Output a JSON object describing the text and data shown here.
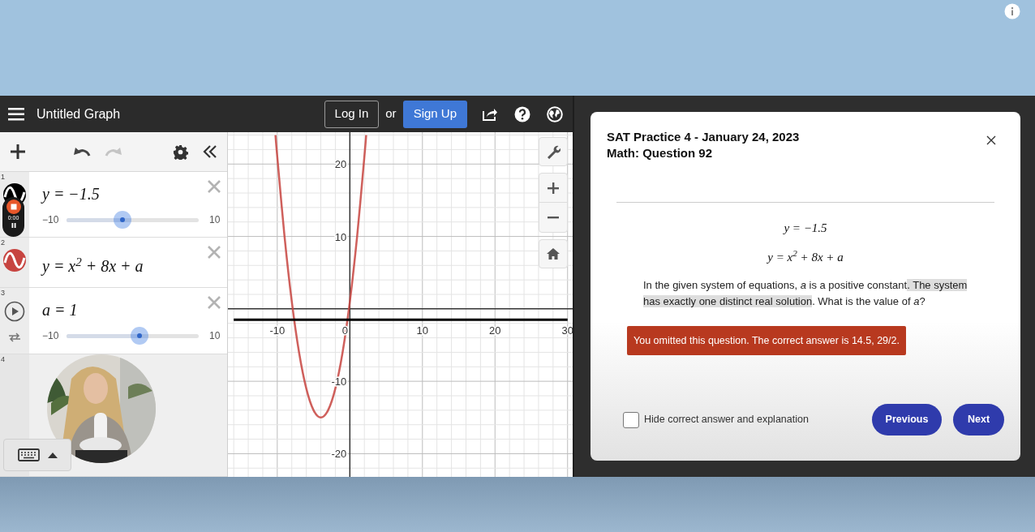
{
  "desmos": {
    "title": "Untitled Graph",
    "login": "Log In",
    "or": "or",
    "signup": "Sign Up",
    "expressions": [
      {
        "kind": "graph",
        "number": "1",
        "color": "#000000",
        "expression": "y = −1.5",
        "slider": {
          "min": "−10",
          "max": "10",
          "level": 0.425
        }
      },
      {
        "kind": "graph",
        "number": "2",
        "color": "#c74440",
        "expression": "y = x$^{2}$ + 8x + a"
      },
      {
        "kind": "variable",
        "number": "3",
        "expression": "a = 1",
        "slider": {
          "min": "−10",
          "max": "10",
          "level": 0.55
        }
      },
      {
        "kind": "empty",
        "number": "4"
      }
    ],
    "recorder": {
      "time": "0:00"
    },
    "graph": {
      "chart_data": {
        "type": "line",
        "x": [
          -16,
          -10.25,
          -10,
          -9,
          -8,
          -7,
          -6,
          -5,
          -4,
          -3,
          -2,
          -1,
          0,
          1,
          2,
          2.25,
          30
        ],
        "series": [
          {
            "color": "#c74440",
            "values": [
              null,
              24,
              21,
              10,
              1,
              -6,
              -11,
              -14,
              -15,
              -14,
              -11,
              -6,
              1,
              10,
              21,
              24,
              null
            ]
          },
          {
            "color": "#000000",
            "values": [
              -1.5,
              -1.5,
              -1.5,
              -1.5,
              -1.5,
              -1.5,
              -1.5,
              -1.5,
              -1.5,
              -1.5,
              -1.5,
              -1.5,
              -1.5,
              -1.5,
              -1.5,
              -1.5,
              -1.5
            ]
          }
        ],
        "grid": true,
        "xlim": [
          -16.8,
          30.7
        ],
        "ylim": [
          -23.2,
          24.4
        ],
        "xticks": [
          {
            "value": -10,
            "label": "-10"
          },
          {
            "value": 0,
            "label": "0"
          },
          {
            "value": 10,
            "label": "10"
          },
          {
            "value": 20,
            "label": "20"
          },
          {
            "value": 30,
            "label": "30"
          }
        ],
        "yticks": [
          {
            "value": 20,
            "label": "20"
          },
          {
            "value": 10,
            "label": "10"
          },
          {
            "value": -10,
            "label": "-10"
          },
          {
            "value": -20,
            "label": "-20"
          }
        ]
      }
    }
  },
  "modal": {
    "title_lines": [
      "SAT Practice 4 - January 24, 2023",
      "Math: Question 92"
    ],
    "equations": [
      "y = −1.5",
      "y = x$^{2}$ + 8x + a"
    ],
    "question": [
      {
        "text": "In the given system of equations, *a* is a positive constant",
        "highlighted": false
      },
      {
        "text": ". The system has exactly one distinct real solution",
        "highlighted": true
      },
      {
        "text": ". What is the value of *a*?",
        "highlighted": false
      }
    ],
    "alert": "You omitted this question. The correct answer is 14.5, 29/2.",
    "hide_answer": {
      "label": "Hide correct answer and explanation",
      "checked": false
    },
    "buttons": [
      "Previous",
      "Next"
    ]
  }
}
